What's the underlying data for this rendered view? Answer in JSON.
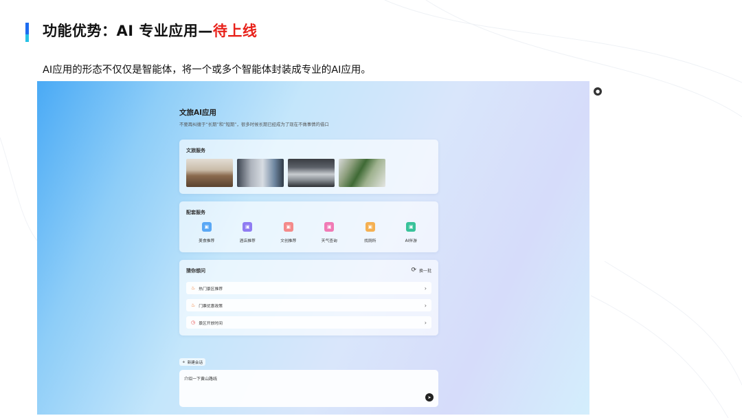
{
  "slide": {
    "title_prefix": "功能优势：AI 专业应用—",
    "title_highlight": "待上线",
    "subtitle": "AI应用的形态不仅仅是智能体，将一个或多个智能体封装成专业的AI应用。"
  },
  "app": {
    "title": "文旅AI应用",
    "description": "不要再纠缠于“长期”和“短期”，很多时候长期已经成为了现在不做事情的借口",
    "culture_service": {
      "title": "文旅服务",
      "photos": [
        "photo-1",
        "photo-2",
        "photo-3",
        "photo-4"
      ]
    },
    "support_service": {
      "title": "配套服务",
      "items": [
        {
          "label": "美食推荐",
          "icon": "food-icon",
          "color": "#5aa8f5"
        },
        {
          "label": "酒店推荐",
          "icon": "hotel-icon",
          "color": "#8f7cf2"
        },
        {
          "label": "文创推荐",
          "icon": "gift-icon",
          "color": "#f48a8a"
        },
        {
          "label": "天气查询",
          "icon": "weather-icon",
          "color": "#f07ab5"
        },
        {
          "label": "找厕所",
          "icon": "toilet-icon",
          "color": "#f5b052"
        },
        {
          "label": "AI伴游",
          "icon": "ai-guide-icon",
          "color": "#39c29a"
        }
      ]
    },
    "guess": {
      "title": "猜你想问",
      "refresh_label": "换一批",
      "questions": [
        {
          "text": "热门景区推荐",
          "icon": "fire-icon"
        },
        {
          "text": "门票优惠政策",
          "icon": "fire-icon"
        },
        {
          "text": "景区开放时间",
          "icon": "clock-icon"
        }
      ]
    },
    "new_chat_label": "新建会话",
    "input_value": "介绍一下黄山路线"
  }
}
